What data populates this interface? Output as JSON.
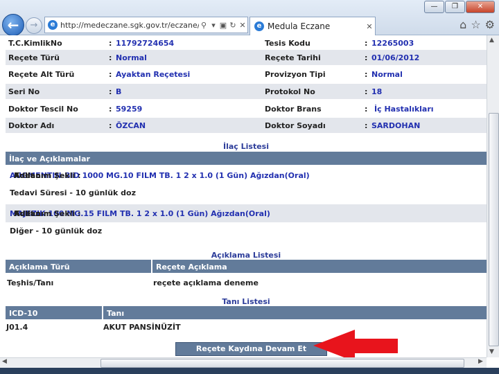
{
  "browser": {
    "url": "http://medeczane.sgk.gov.tr/eczane/faces/",
    "tab_title": "Medula Eczane",
    "window_controls": {
      "minimize": "—",
      "maximize": "❐",
      "close": "✕"
    },
    "icons": [
      "home-icon",
      "star-icon",
      "gear-icon"
    ]
  },
  "prescription": {
    "rows": [
      {
        "l1": "T.C.KimlikNo",
        "v1": "11792724654",
        "l2": "Tesis Kodu",
        "v2": "12265003"
      },
      {
        "l1": "Reçete Türü",
        "v1": "Normal",
        "l2": "Reçete Tarihi",
        "v2": "01/06/2012"
      },
      {
        "l1": "Reçete Alt Türü",
        "v1": "Ayaktan Reçetesi",
        "l2": "Provizyon Tipi",
        "v2": "Normal"
      },
      {
        "l1": "Seri No",
        "v1": "B",
        "l2": "Protokol No",
        "v2": "18"
      },
      {
        "l1": "Doktor Tescil No",
        "v1": "59259",
        "l2": "Doktor Brans",
        "v2": "İç Hastalıkları"
      },
      {
        "l1": "Doktor Adı",
        "v1": "ÖZCAN",
        "l2": "Doktor Soyadı",
        "v2": "SARDOHAN"
      }
    ],
    "separator": ":"
  },
  "drug_section": {
    "title": "İlaç Listesi",
    "header": "İlaç ve Açıklamalar",
    "drugs": [
      {
        "name": "AUGMENTIN-BID 1000 MG.10 FILM TB.",
        "adet": "1",
        "kullanim": "2 x 1.0 (1 Gün)",
        "sekil": "Ağızdan(Oral)",
        "note": "Tedavi Süresi - 10 günlük doz"
      },
      {
        "name": "MAJEZIK 100 MG.15 FILM TB.",
        "adet": "1",
        "kullanim": "2 x 1.0 (1 Gün)",
        "sekil": "Ağızdan(Oral)",
        "note": "Diğer - 10 günlük doz"
      }
    ],
    "labels": {
      "adi": "Adı :",
      "adet": "Adet :",
      "kullanim": "Kullanım :",
      "sekil": "Kullanım Şekli :"
    }
  },
  "explanation_section": {
    "title": "Açıklama Listesi",
    "col1": "Açıklama Türü",
    "col2": "Reçete Açıklama",
    "row": {
      "type": "Teşhis/Tanı",
      "text": "reçete açıklama deneme"
    }
  },
  "diagnosis_section": {
    "title": "Tanı Listesi",
    "col1": "ICD-10",
    "col2": "Tanı",
    "row": {
      "code": "J01.4",
      "name": "AKUT PANSİNÜZİT"
    }
  },
  "action_button": "Reçete Kaydına Devam Et",
  "colors": {
    "header_bar": "#627b9a",
    "value_text": "#2230b0",
    "arrow": "#e8141c",
    "alt_row": "#e3e6ec"
  }
}
